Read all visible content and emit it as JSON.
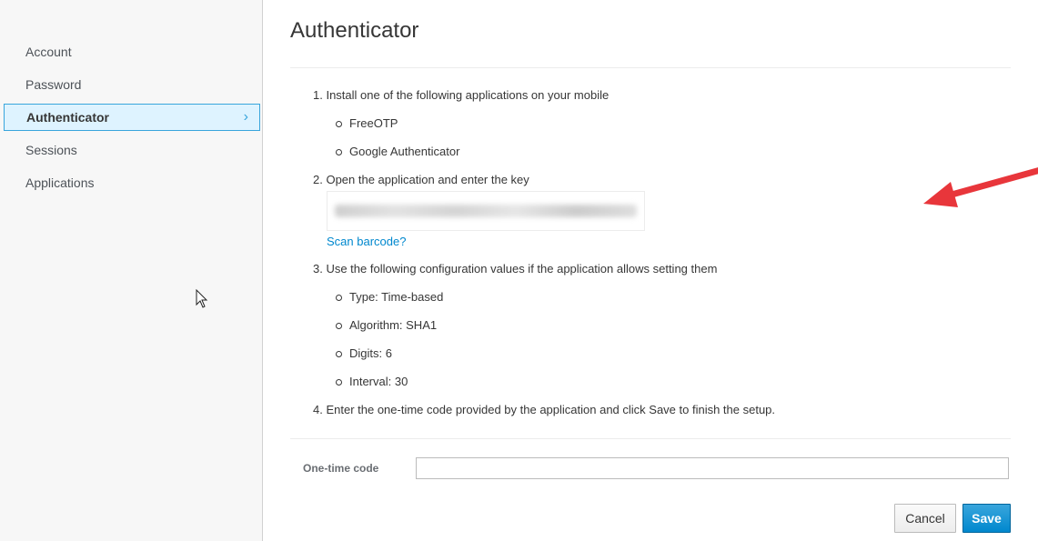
{
  "sidebar": {
    "items": [
      {
        "label": "Account"
      },
      {
        "label": "Password"
      },
      {
        "label": "Authenticator",
        "chevron": "›"
      },
      {
        "label": "Sessions"
      },
      {
        "label": "Applications"
      }
    ]
  },
  "main": {
    "title": "Authenticator",
    "steps": [
      "1. Install one of the following applications on your mobile",
      "2. Open the application and enter the key",
      "3. Use the following configuration values if the application allows setting them",
      "4. Enter the one-time code provided by the application and click Save to finish the setup."
    ],
    "apps": [
      "FreeOTP",
      "Google Authenticator"
    ],
    "scan_link": "Scan barcode?",
    "config": [
      "Type: Time-based",
      "Algorithm: SHA1",
      "Digits: 6",
      "Interval: 30"
    ],
    "otp_label": "One-time code",
    "otp_value": "",
    "cancel_label": "Cancel",
    "save_label": "Save"
  },
  "colors": {
    "accent": "#0088ce",
    "active_bg": "#def3ff",
    "arrow": "#e8363b"
  }
}
